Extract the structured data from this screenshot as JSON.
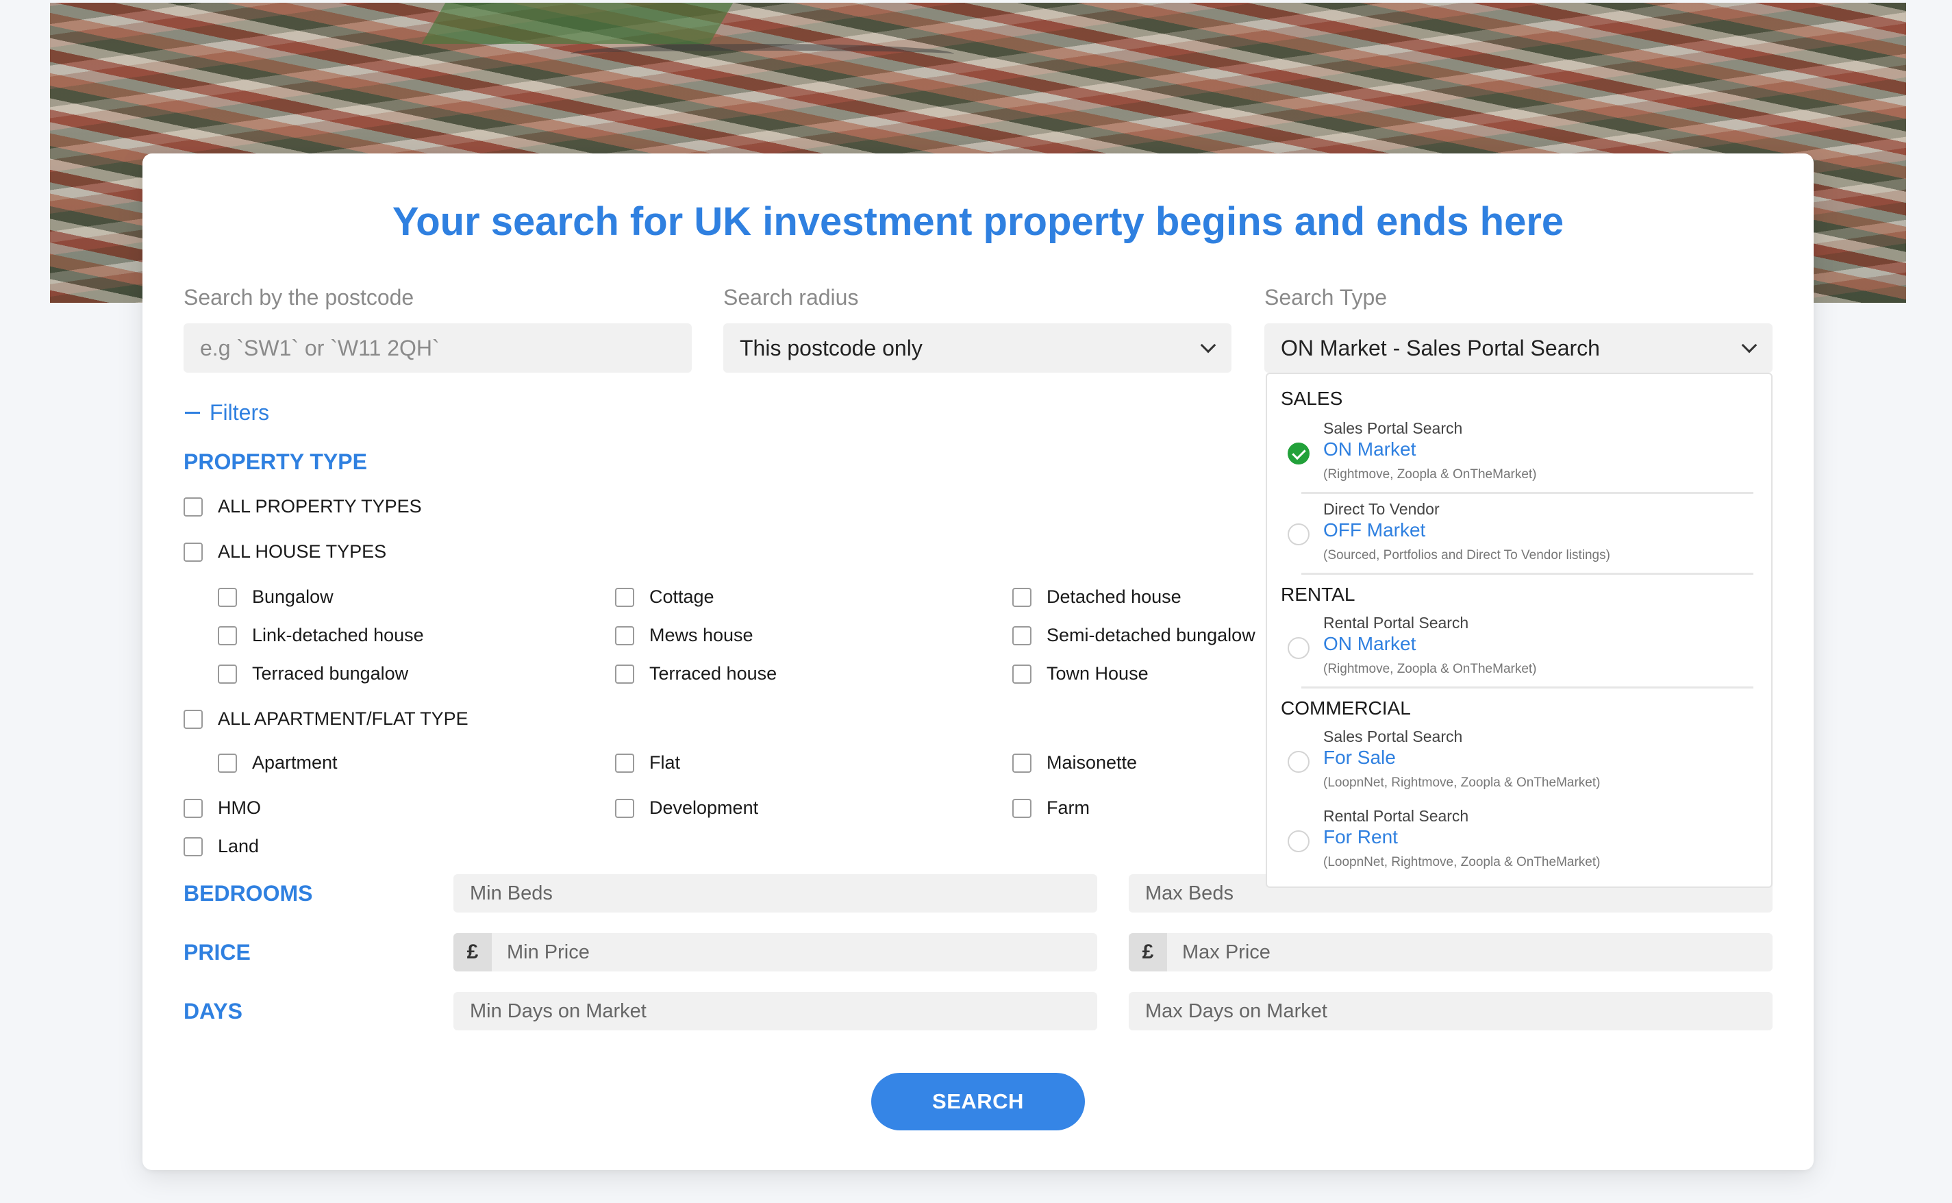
{
  "headline": "Your search for UK investment property begins and ends here",
  "postcode": {
    "label": "Search by the postcode",
    "placeholder": "e.g `SW1` or `W11 2QH`"
  },
  "radius": {
    "label": "Search radius",
    "value": "This postcode only"
  },
  "search_type": {
    "label": "Search Type",
    "value": "ON Market - Sales Portal Search",
    "groups": [
      {
        "title": "SALES",
        "options": [
          {
            "small": "Sales Portal Search",
            "main": "ON Market",
            "note": "(Rightmove, Zoopla & OnTheMarket)",
            "selected": true
          },
          {
            "small": "Direct To Vendor",
            "main": "OFF Market",
            "note": "(Sourced, Portfolios and Direct To Vendor listings)",
            "selected": false
          }
        ]
      },
      {
        "title": "RENTAL",
        "options": [
          {
            "small": "Rental Portal Search",
            "main": "ON Market",
            "note": "(Rightmove, Zoopla & OnTheMarket)",
            "selected": false
          }
        ]
      },
      {
        "title": "COMMERCIAL",
        "options": [
          {
            "small": "Sales Portal Search",
            "main": "For Sale",
            "note": "(LoopnNet, Rightmove, Zoopla & OnTheMarket)",
            "selected": false
          },
          {
            "small": "Rental Portal Search",
            "main": "For Rent",
            "note": "(LoopnNet, Rightmove, Zoopla & OnTheMarket)",
            "selected": false
          }
        ]
      }
    ]
  },
  "filters_toggle": "Filters",
  "property_type": {
    "title": "PROPERTY TYPE",
    "all_property": "ALL PROPERTY TYPES",
    "all_house": "ALL HOUSE TYPES",
    "house_types": [
      "Bungalow",
      "Cottage",
      "Detached house",
      "Link-detached house",
      "Mews house",
      "Semi-detached bungalow",
      "Terraced bungalow",
      "Terraced house",
      "Town House"
    ],
    "all_apartment": "ALL APARTMENT/FLAT TYPE",
    "apartment_types": [
      "Apartment",
      "Flat",
      "Maisonette"
    ],
    "other_types": [
      "HMO",
      "Development",
      "Farm",
      "Land"
    ]
  },
  "bedrooms": {
    "title": "BEDROOMS",
    "min": "Min Beds",
    "max": "Max Beds"
  },
  "price": {
    "title": "PRICE",
    "currency": "£",
    "min": "Min Price",
    "max": "Max Price"
  },
  "days": {
    "title": "DAYS",
    "min": "Min Days on Market",
    "max": "Max Days on Market"
  },
  "search_button": "SEARCH",
  "colors": {
    "accent": "#2f80e0",
    "button": "#3585e6",
    "check_green": "#22a13a",
    "field_bg": "#f1f1f1"
  }
}
